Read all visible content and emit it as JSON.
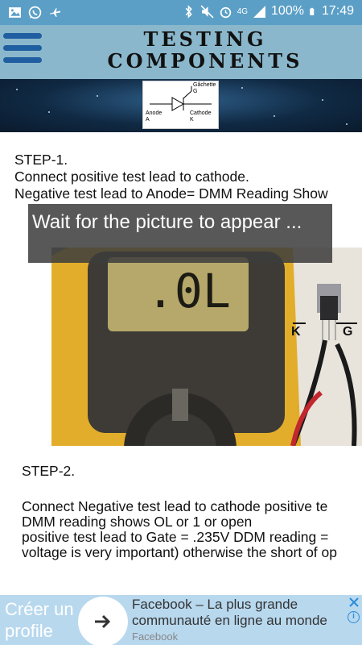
{
  "status_bar": {
    "battery": "100%",
    "time": "17:49",
    "network": "4G",
    "left_icons": [
      "image-icon",
      "whatsapp-icon",
      "airplane-icon"
    ],
    "right_icons": [
      "bluetooth-icon",
      "mute-icon",
      "alarm-icon",
      "signal-icon",
      "battery-icon"
    ]
  },
  "header": {
    "title": "TESTING\nCOMPONENTS",
    "menu_icon": "hamburger-menu-icon"
  },
  "diagram": {
    "gate_label": "Gâchette\nG",
    "anode_label": "Anode\nA",
    "cathode_label": "Cathode\nK"
  },
  "step1": {
    "title": "STEP-1.",
    "line1": "Connect positive test lead to cathode.",
    "line2": "Negative test lead to Anode= DMM Reading Show"
  },
  "photo": {
    "meter_reading": ".0L",
    "label_k": "K",
    "label_g": "G"
  },
  "toast": {
    "text": "Wait for the picture to appear ..."
  },
  "step2": {
    "title": "STEP-2.",
    "line1": "Connect Negative test lead to cathode positive te",
    "line2": "DMM reading shows OL or 1 or open",
    "line3": "positive test lead to Gate = .235V DDM reading =",
    "line4": "voltage is very important) otherwise the short of op"
  },
  "ad": {
    "left_text": "Créer un\nprofile",
    "title": "Facebook – La plus grande",
    "description": "communauté en ligne au monde",
    "source": "Facebook",
    "colors": {
      "background": "#b8d8ee",
      "accent": "#2b8cd9"
    }
  },
  "colors": {
    "status_bar": "#5b9fc6",
    "header": "#8ab7cb",
    "menu_icon": "#1f5ea0"
  }
}
